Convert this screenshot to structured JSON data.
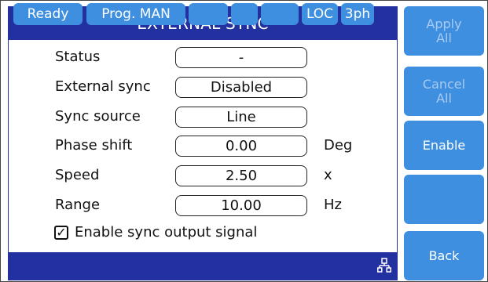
{
  "title": "EXTERNAL SYNC",
  "rows": [
    {
      "label": "Status",
      "value": "-",
      "unit": ""
    },
    {
      "label": "External sync",
      "value": "Disabled",
      "unit": ""
    },
    {
      "label": "Sync source",
      "value": "Line",
      "unit": ""
    },
    {
      "label": "Phase shift",
      "value": "0.00",
      "unit": "Deg"
    },
    {
      "label": "Speed",
      "value": "2.50",
      "unit": "x"
    },
    {
      "label": "Range",
      "value": "10.00",
      "unit": "Hz"
    }
  ],
  "checkbox": {
    "label": "Enable sync output signal",
    "checked": true,
    "mark": "✓"
  },
  "status_bar": {
    "ready": "Ready",
    "program": "Prog. MAN",
    "loc": "LOC",
    "phase": "3ph",
    "network_icon": "network-icon"
  },
  "softkeys": {
    "apply_line1": "Apply",
    "apply_line2": "All",
    "cancel_line1": "Cancel",
    "cancel_line2": "All",
    "enable": "Enable",
    "blank": "",
    "back": "Back"
  },
  "colors": {
    "navy": "#2330a0",
    "accent": "#3f8fe0",
    "dimmed_text": "#a8cbf3"
  }
}
